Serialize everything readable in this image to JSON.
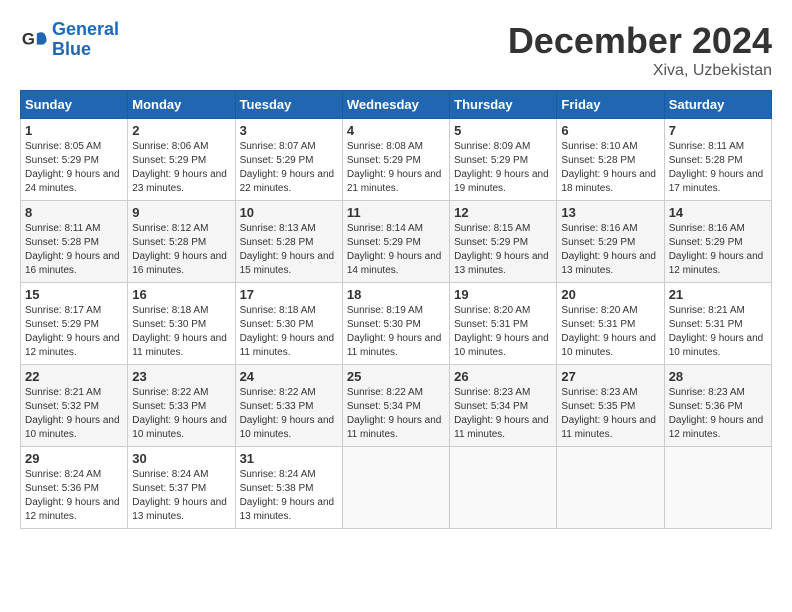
{
  "logo": {
    "line1": "General",
    "line2": "Blue"
  },
  "title": "December 2024",
  "location": "Xiva, Uzbekistan",
  "days_of_week": [
    "Sunday",
    "Monday",
    "Tuesday",
    "Wednesday",
    "Thursday",
    "Friday",
    "Saturday"
  ],
  "weeks": [
    [
      {
        "day": "1",
        "sunrise": "8:05 AM",
        "sunset": "5:29 PM",
        "daylight": "9 hours and 24 minutes."
      },
      {
        "day": "2",
        "sunrise": "8:06 AM",
        "sunset": "5:29 PM",
        "daylight": "9 hours and 23 minutes."
      },
      {
        "day": "3",
        "sunrise": "8:07 AM",
        "sunset": "5:29 PM",
        "daylight": "9 hours and 22 minutes."
      },
      {
        "day": "4",
        "sunrise": "8:08 AM",
        "sunset": "5:29 PM",
        "daylight": "9 hours and 21 minutes."
      },
      {
        "day": "5",
        "sunrise": "8:09 AM",
        "sunset": "5:29 PM",
        "daylight": "9 hours and 19 minutes."
      },
      {
        "day": "6",
        "sunrise": "8:10 AM",
        "sunset": "5:28 PM",
        "daylight": "9 hours and 18 minutes."
      },
      {
        "day": "7",
        "sunrise": "8:11 AM",
        "sunset": "5:28 PM",
        "daylight": "9 hours and 17 minutes."
      }
    ],
    [
      {
        "day": "8",
        "sunrise": "8:11 AM",
        "sunset": "5:28 PM",
        "daylight": "9 hours and 16 minutes."
      },
      {
        "day": "9",
        "sunrise": "8:12 AM",
        "sunset": "5:28 PM",
        "daylight": "9 hours and 16 minutes."
      },
      {
        "day": "10",
        "sunrise": "8:13 AM",
        "sunset": "5:28 PM",
        "daylight": "9 hours and 15 minutes."
      },
      {
        "day": "11",
        "sunrise": "8:14 AM",
        "sunset": "5:29 PM",
        "daylight": "9 hours and 14 minutes."
      },
      {
        "day": "12",
        "sunrise": "8:15 AM",
        "sunset": "5:29 PM",
        "daylight": "9 hours and 13 minutes."
      },
      {
        "day": "13",
        "sunrise": "8:16 AM",
        "sunset": "5:29 PM",
        "daylight": "9 hours and 13 minutes."
      },
      {
        "day": "14",
        "sunrise": "8:16 AM",
        "sunset": "5:29 PM",
        "daylight": "9 hours and 12 minutes."
      }
    ],
    [
      {
        "day": "15",
        "sunrise": "8:17 AM",
        "sunset": "5:29 PM",
        "daylight": "9 hours and 12 minutes."
      },
      {
        "day": "16",
        "sunrise": "8:18 AM",
        "sunset": "5:30 PM",
        "daylight": "9 hours and 11 minutes."
      },
      {
        "day": "17",
        "sunrise": "8:18 AM",
        "sunset": "5:30 PM",
        "daylight": "9 hours and 11 minutes."
      },
      {
        "day": "18",
        "sunrise": "8:19 AM",
        "sunset": "5:30 PM",
        "daylight": "9 hours and 11 minutes."
      },
      {
        "day": "19",
        "sunrise": "8:20 AM",
        "sunset": "5:31 PM",
        "daylight": "9 hours and 10 minutes."
      },
      {
        "day": "20",
        "sunrise": "8:20 AM",
        "sunset": "5:31 PM",
        "daylight": "9 hours and 10 minutes."
      },
      {
        "day": "21",
        "sunrise": "8:21 AM",
        "sunset": "5:31 PM",
        "daylight": "9 hours and 10 minutes."
      }
    ],
    [
      {
        "day": "22",
        "sunrise": "8:21 AM",
        "sunset": "5:32 PM",
        "daylight": "9 hours and 10 minutes."
      },
      {
        "day": "23",
        "sunrise": "8:22 AM",
        "sunset": "5:33 PM",
        "daylight": "9 hours and 10 minutes."
      },
      {
        "day": "24",
        "sunrise": "8:22 AM",
        "sunset": "5:33 PM",
        "daylight": "9 hours and 10 minutes."
      },
      {
        "day": "25",
        "sunrise": "8:22 AM",
        "sunset": "5:34 PM",
        "daylight": "9 hours and 11 minutes."
      },
      {
        "day": "26",
        "sunrise": "8:23 AM",
        "sunset": "5:34 PM",
        "daylight": "9 hours and 11 minutes."
      },
      {
        "day": "27",
        "sunrise": "8:23 AM",
        "sunset": "5:35 PM",
        "daylight": "9 hours and 11 minutes."
      },
      {
        "day": "28",
        "sunrise": "8:23 AM",
        "sunset": "5:36 PM",
        "daylight": "9 hours and 12 minutes."
      }
    ],
    [
      {
        "day": "29",
        "sunrise": "8:24 AM",
        "sunset": "5:36 PM",
        "daylight": "9 hours and 12 minutes."
      },
      {
        "day": "30",
        "sunrise": "8:24 AM",
        "sunset": "5:37 PM",
        "daylight": "9 hours and 13 minutes."
      },
      {
        "day": "31",
        "sunrise": "8:24 AM",
        "sunset": "5:38 PM",
        "daylight": "9 hours and 13 minutes."
      },
      null,
      null,
      null,
      null
    ]
  ]
}
